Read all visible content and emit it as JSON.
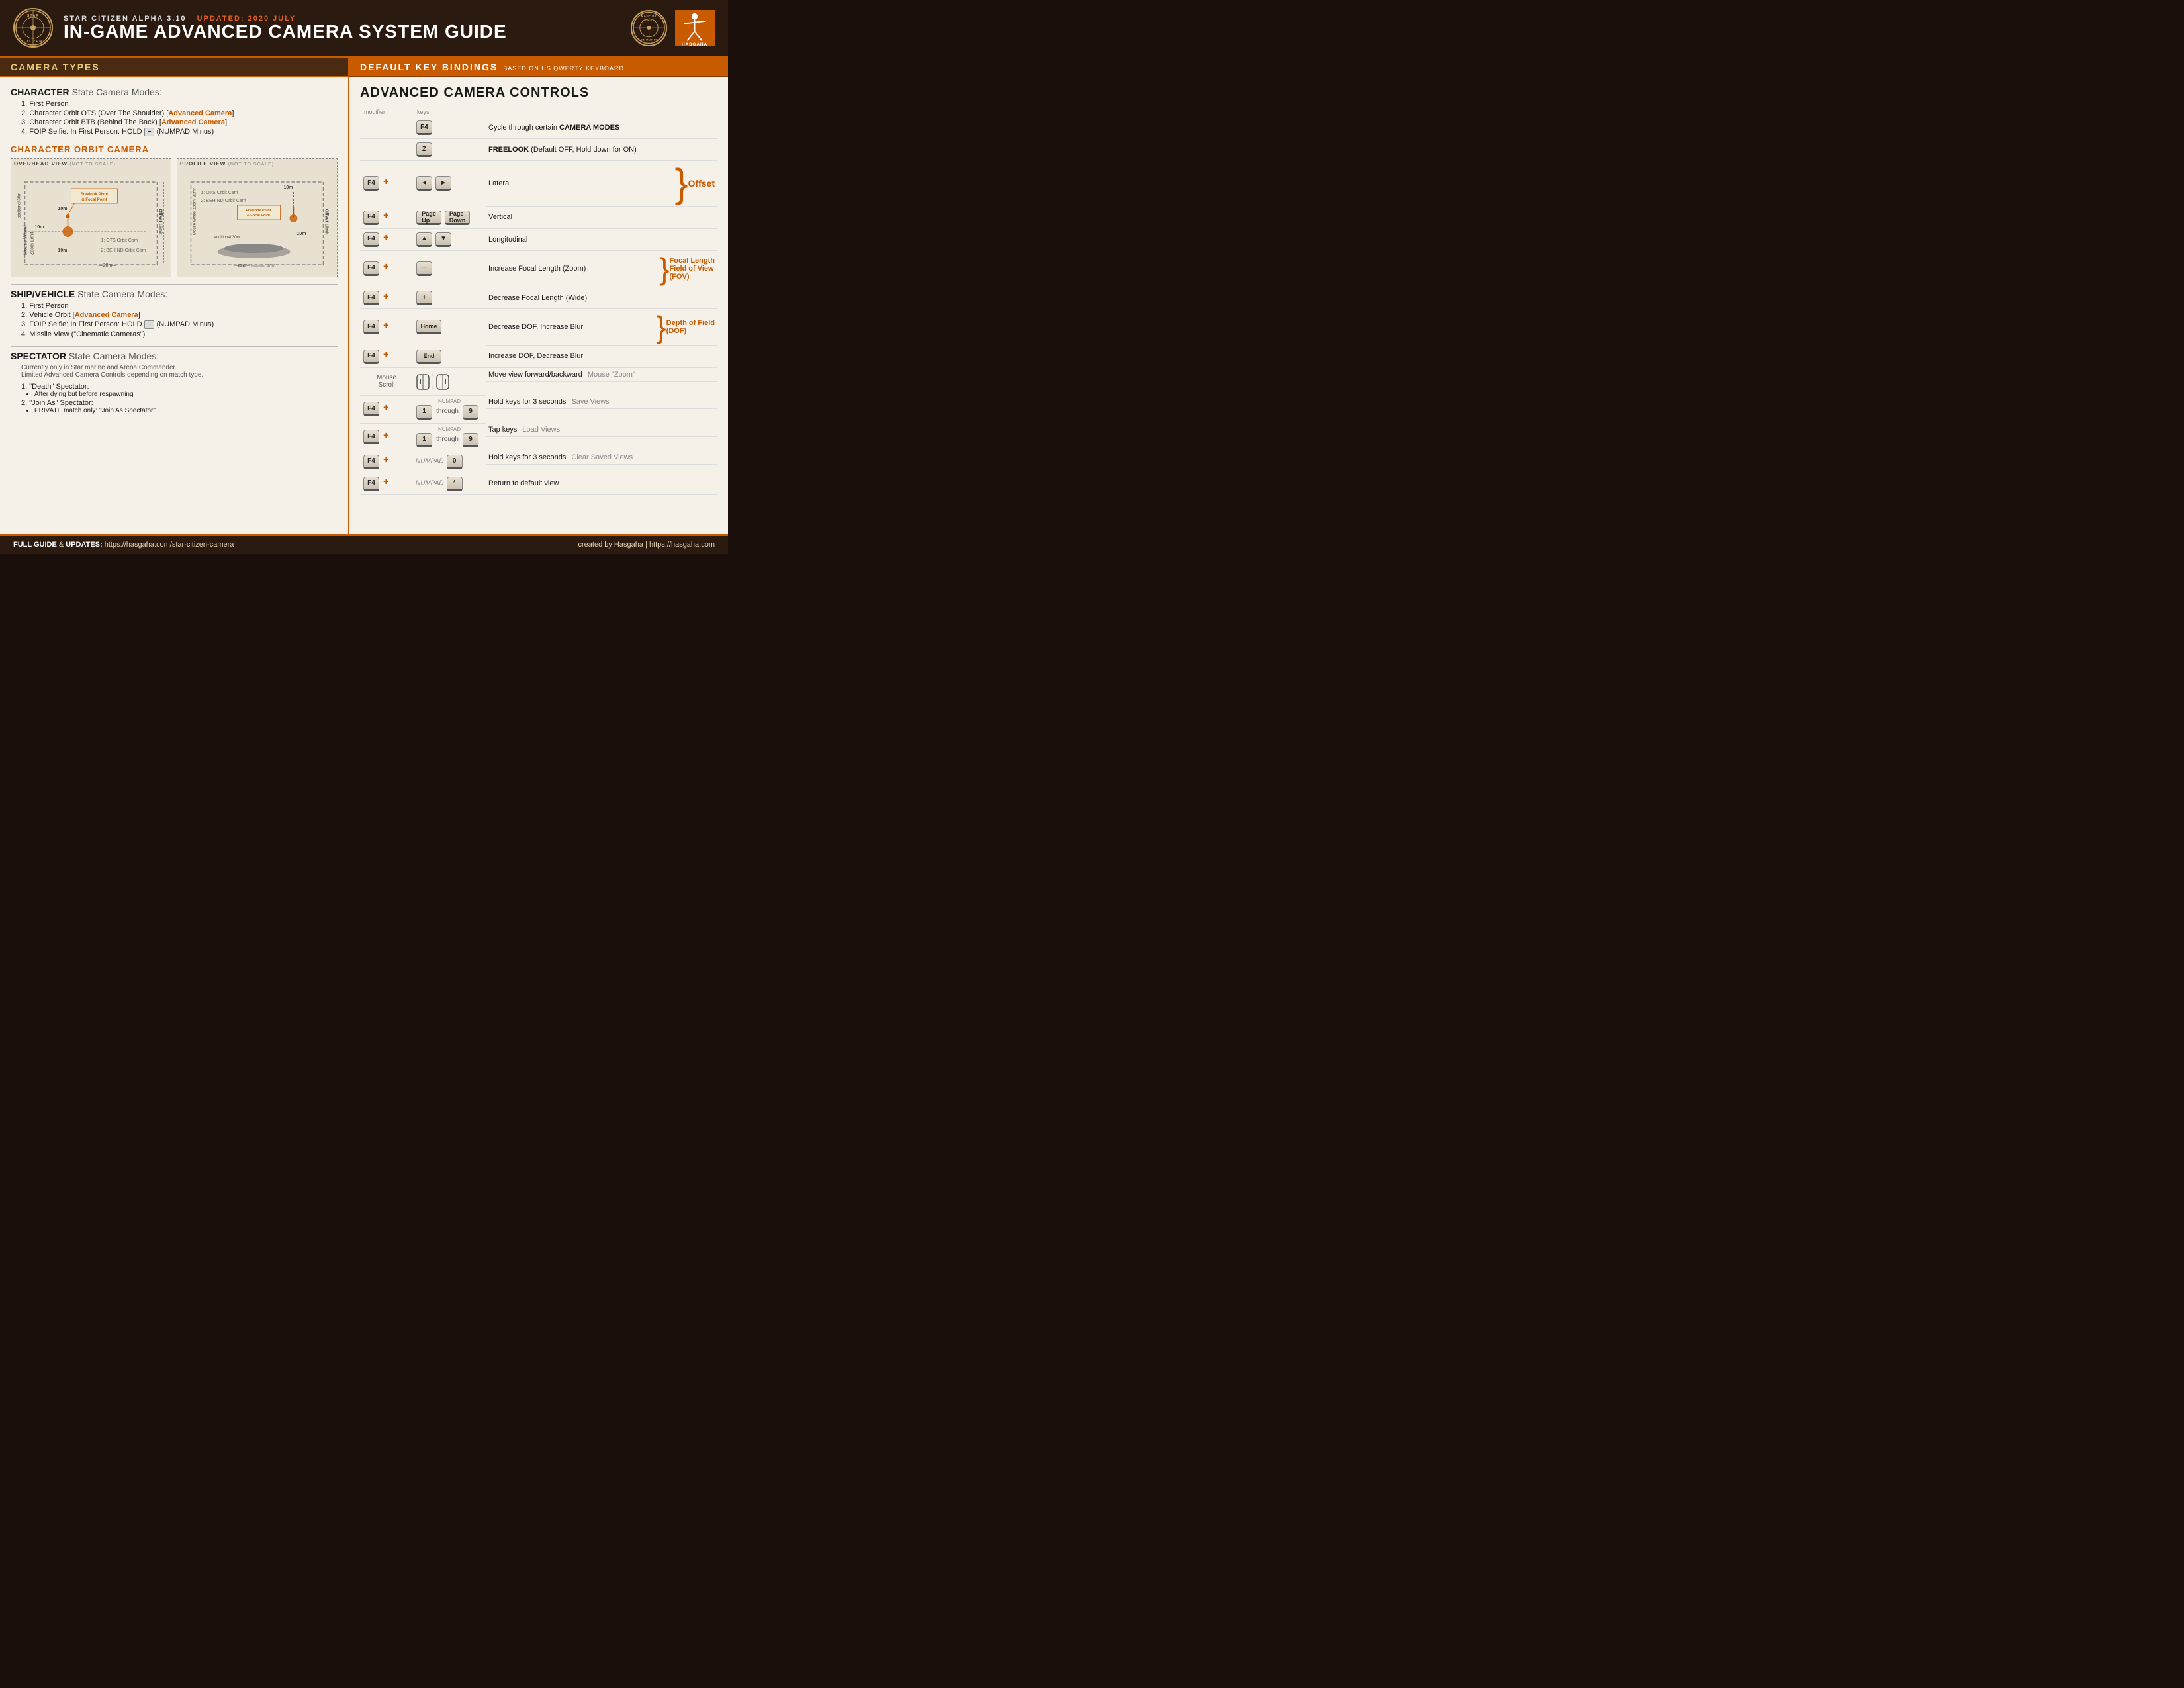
{
  "header": {
    "logo_text": "STAR\nCITIZEN",
    "subtitle": "STAR CITIZEN ALPHA 3.10",
    "updated": "UPDATED: 2020 JULY",
    "main_title": "IN-GAME ADVANCED CAMERA SYSTEM GUIDE",
    "community_text": "MADE BY\nTHE\nCOMMUNITY",
    "hasgaha_text": "HASGAHA"
  },
  "left_panel": {
    "section_header": "CAMERA TYPES",
    "character_state": {
      "title": "CHARACTER",
      "subtitle": "State Camera Modes:",
      "items": [
        "1.  First Person",
        "2.  Character Orbit OTS (Over The Shoulder) [Advanced Camera]",
        "3.  Character Orbit BTB (Behind The Back) [Advanced Camera]",
        "4.  FOIP Selfie:  In First Person: HOLD − (NUMPAD Minus)"
      ]
    },
    "orbit_camera": {
      "title": "CHARACTER ORBIT CAMERA",
      "overhead_label": "OVERHEAD VIEW",
      "overhead_sub": "(not to scale)",
      "profile_label": "PROFILE VIEW",
      "profile_sub": "(not to scale)"
    },
    "ship_state": {
      "title": "SHIP/VEHICLE",
      "subtitle": "State  Camera Modes:",
      "items": [
        "1.  First Person",
        "2.  Vehicle Orbit [Advanced Camera]",
        "3.  FOIP Selfie:  In First Person: HOLD − (NUMPAD Minus)",
        "4.  Missile View (\"Cinematic Cameras\")"
      ]
    },
    "spectator_state": {
      "title": "SPECTATOR",
      "subtitle": "State  Camera Modes:",
      "intro": "Currently only in Star marine and Arena Commander.\nLimited Advanced Camera Controls depending on match type.",
      "items": [
        {
          "label": "1.  \"Death\" Spectator:",
          "sub": [
            "After dying but before respawning"
          ]
        },
        {
          "label": "2.  \"Join As\" Spectator:",
          "sub": [
            "PRIVATE match only: \"Join As Spectator\""
          ]
        }
      ]
    }
  },
  "right_panel": {
    "section_header": "DEFAULT KEY BINDINGS",
    "section_sub": "based on US QWERTY keyboard",
    "controls_title": "ADVANCED CAMERA CONTROLS",
    "col_modifier": "modifier",
    "col_keys": "keys",
    "bindings": [
      {
        "modifier": "",
        "keys": "F4",
        "description": "Cycle through certain CAMERA MODES",
        "side_label": ""
      },
      {
        "modifier": "",
        "keys": "Z",
        "description": "FREELOOK (Default OFF, Hold down for ON)",
        "side_label": ""
      },
      {
        "modifier": "F4 +",
        "keys": "◄ ►",
        "description": "Lateral",
        "side_label": "Offset",
        "brace": true,
        "brace_rows": 3
      },
      {
        "modifier": "F4 +",
        "keys": "Page Up / Page Down",
        "description": "Vertical",
        "side_label": ""
      },
      {
        "modifier": "F4 +",
        "keys": "▲ ▼",
        "description": "Longitudinal",
        "side_label": ""
      },
      {
        "modifier": "F4 +",
        "keys": "−",
        "description": "Increase Focal Length (Zoom)",
        "side_label": "Focal Length\nField of View\n(FOV)",
        "brace": true,
        "brace_rows": 2
      },
      {
        "modifier": "F4 +",
        "keys": "+",
        "description": "Decrease Focal Length (Wide)",
        "side_label": ""
      },
      {
        "modifier": "F4 +",
        "keys": "Home",
        "description": "Decrease DOF, Increase Blur",
        "side_label": "Depth of Field\n(DOF)",
        "brace": true,
        "brace_rows": 2
      },
      {
        "modifier": "F4 +",
        "keys": "End",
        "description": "Increase DOF, Decrease Blur",
        "side_label": ""
      },
      {
        "modifier": "Mouse\nScroll",
        "keys": "scroll",
        "description": "Move view forward/backward",
        "side_label": "Mouse \"Zoom\""
      },
      {
        "modifier": "F4 +",
        "keys": "NUMPAD 1 through 9",
        "description": "Hold keys for 3 seconds",
        "side_label": "Save Views"
      },
      {
        "modifier": "F4 +",
        "keys": "NUMPAD 1 through 9",
        "description": "Tap keys",
        "side_label": "Load Views"
      },
      {
        "modifier": "F4 +",
        "keys": "NUMPAD 0",
        "description": "Hold keys for 3 seconds",
        "side_label": "Clear Saved Views"
      },
      {
        "modifier": "F4 +",
        "keys": "NUMPAD *",
        "description": "Return to default view",
        "side_label": ""
      }
    ]
  },
  "footer": {
    "left_label": "FULL GUIDE",
    "left_and": "&",
    "left_updates": "UPDATES:",
    "left_url": "https://hasgaha.com/star-citizen-camera",
    "right_text": "created by Hasgaha",
    "right_separator": "|",
    "right_url": "https://hasgaha.com"
  }
}
